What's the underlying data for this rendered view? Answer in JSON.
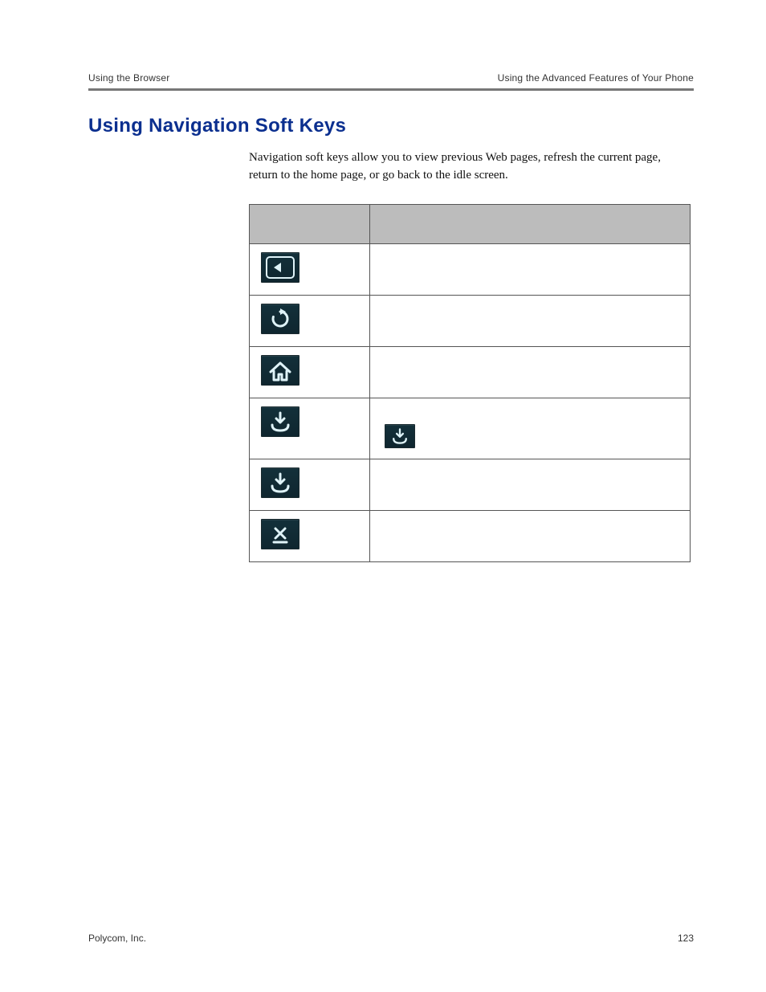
{
  "header": {
    "left": "Using the Browser",
    "right": "Using the Advanced Features of Your Phone"
  },
  "section": {
    "title": "Using Navigation Soft Keys",
    "intro": "Navigation soft keys allow you to view previous Web pages, refresh the current page, return to the home page, or go back to the idle screen."
  },
  "table": {
    "headers": {
      "icon": "",
      "action": ""
    },
    "rows": [
      {
        "icon": "back-icon",
        "action_before": "",
        "inline_icon": "",
        "action_after": ""
      },
      {
        "icon": "refresh-icon",
        "action_before": "",
        "inline_icon": "",
        "action_after": ""
      },
      {
        "icon": "home-icon",
        "action_before": "",
        "inline_icon": "",
        "action_after": ""
      },
      {
        "icon": "download-to-tray-icon",
        "action_before": "",
        "inline_icon": "download-to-tray-icon",
        "action_after": ""
      },
      {
        "icon": "download-to-tray-icon",
        "action_before": "",
        "inline_icon": "",
        "action_after": ""
      },
      {
        "icon": "exit-icon",
        "action_before": "",
        "inline_icon": "",
        "action_after": ""
      }
    ]
  },
  "footer": {
    "left": "Polycom, Inc.",
    "right": "123"
  }
}
